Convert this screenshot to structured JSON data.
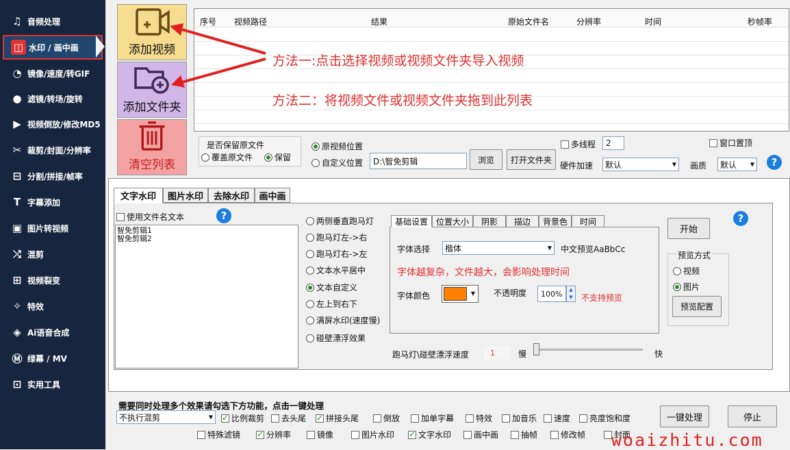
{
  "sidebar": {
    "items": [
      {
        "label": "音频处理",
        "icon": "music-note-icon"
      },
      {
        "label": "水印 / 画中画",
        "icon": "watermark-icon",
        "active": true
      },
      {
        "label": "镜像/速度/转GIF",
        "icon": "speed-gauge-icon"
      },
      {
        "label": "滤镜/转场/旋转",
        "icon": "filter-dots-icon"
      },
      {
        "label": "视频倒放/修改MD5",
        "icon": "reverse-video-icon"
      },
      {
        "label": "裁剪/封面/分辨率",
        "icon": "scissors-icon"
      },
      {
        "label": "分割/拼接/帧率",
        "icon": "split-icon"
      },
      {
        "label": "字幕添加",
        "icon": "subtitle-icon"
      },
      {
        "label": "图片转视频",
        "icon": "image-to-video-icon"
      },
      {
        "label": "混剪",
        "icon": "shuffle-icon"
      },
      {
        "label": "视频裂变",
        "icon": "grid-split-icon"
      },
      {
        "label": "特效",
        "icon": "sparkle-icon"
      },
      {
        "label": "Ai语音合成",
        "icon": "ai-voice-icon"
      },
      {
        "label": "绿幕 / MV",
        "icon": "mv-icon"
      },
      {
        "label": "实用工具",
        "icon": "toolbox-icon"
      }
    ]
  },
  "actions": {
    "add_video": "添加视频",
    "add_folder": "添加文件夹",
    "clear_list": "清空列表"
  },
  "file_table": {
    "columns": [
      "序号",
      "视频路径",
      "结果",
      "原始文件名",
      "分辨率",
      "时间",
      "秒帧率"
    ]
  },
  "annotations": {
    "method1": "方法一:点击选择视频或视频文件夹导入视频",
    "method2": "方法二：将视频文件或视频文件夹拖到此列表"
  },
  "output": {
    "keep_original_label": "是否保留原文件",
    "overwrite": "覆盖原文件",
    "keep": "保留",
    "original_location": "原视频位置",
    "custom_location": "自定义位置",
    "path_value": "D:\\智免剪辑",
    "browse": "浏览",
    "open_folder": "打开文件夹",
    "multithread": "多线程",
    "thread_count": "2",
    "hw_accel_label": "硬件加速",
    "hw_accel_value": "默认",
    "quality_label": "画质",
    "quality_value": "默认",
    "window_top": "窗口置顶"
  },
  "tabs": [
    "文字水印",
    "图片水印",
    "去除水印",
    "画中画"
  ],
  "text_watermark": {
    "use_filename": "使用文件名文本",
    "text_lines": [
      "智免剪辑1",
      "智免剪辑2"
    ],
    "modes": [
      {
        "label": "两侧垂直跑马灯",
        "on": false
      },
      {
        "label": "跑马灯左->右",
        "on": false
      },
      {
        "label": "跑马灯右->左",
        "on": false
      },
      {
        "label": "文本水平居中",
        "on": false
      },
      {
        "label": "文本自定义",
        "on": true
      },
      {
        "label": "左上到右下",
        "on": false
      },
      {
        "label": "满屏水印(速度慢)",
        "on": false
      },
      {
        "label": "碰壁漂浮效果",
        "on": false
      }
    ]
  },
  "settings_tabs": [
    "基础设置",
    "位置大小",
    "阴影",
    "描边",
    "背景色",
    "时间"
  ],
  "basic": {
    "font_label": "字体选择",
    "font_value": "楷体",
    "preview_text": "中文预览AaBbCc",
    "warning": "字体越复杂，文件越大，会影响处理时间",
    "color_label": "字体颜色",
    "font_color": "#ff8000",
    "opacity_label": "不透明度",
    "opacity_value": "100%",
    "no_preview": "不支持预览",
    "speed_label": "跑马灯\\碰壁漂浮速度",
    "speed_value": "1",
    "slow": "慢",
    "fast": "快"
  },
  "right_panel": {
    "start": "开始",
    "preview_mode_label": "预览方式",
    "video": "视频",
    "image": "图片",
    "preview_config": "预览配置"
  },
  "batch": {
    "title": "需要同时处理多个效果请勾选下方功能，点击一键处理",
    "dropdown_value": "不执行混剪",
    "row1": [
      {
        "label": "比例裁剪",
        "on": true
      },
      {
        "label": "去头尾",
        "on": false
      },
      {
        "label": "拼接头尾",
        "on": true
      },
      {
        "label": "倒放",
        "on": false
      },
      {
        "label": "加单字幕",
        "on": false
      },
      {
        "label": "特效",
        "on": false
      },
      {
        "label": "加音乐",
        "on": false
      },
      {
        "label": "速度",
        "on": false
      },
      {
        "label": "亮度饱和度",
        "on": false
      }
    ],
    "row2": [
      {
        "label": "特殊滤镜",
        "on": false
      },
      {
        "label": "分辨率",
        "on": true
      },
      {
        "label": "镜像",
        "on": false
      },
      {
        "label": "图片水印",
        "on": false
      },
      {
        "label": "文字水印",
        "on": true
      },
      {
        "label": "画中画",
        "on": false
      },
      {
        "label": "抽帧",
        "on": false
      },
      {
        "label": "修改帧",
        "on": false
      },
      {
        "label": "封面",
        "on": false
      }
    ],
    "one_click": "一键处理",
    "stop": "停止"
  },
  "watermark_site": "woaizhitu.com"
}
